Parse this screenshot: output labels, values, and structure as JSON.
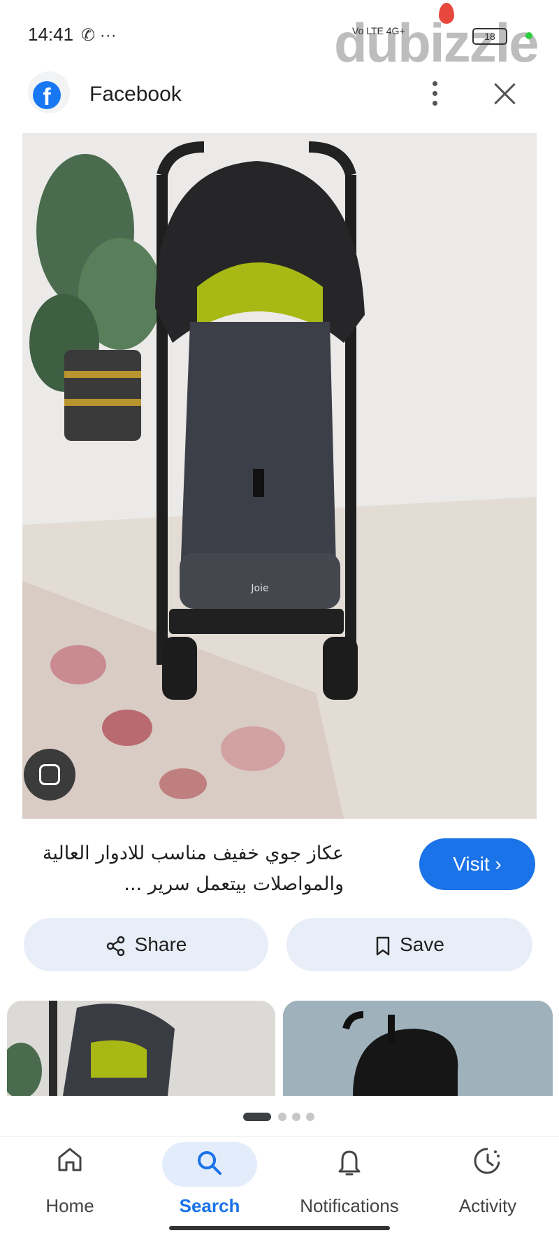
{
  "status_bar": {
    "time": "14:41",
    "left_icons": "✆ ···",
    "network": "Vo LTE 4G+",
    "battery": "18"
  },
  "watermark": "dubizzle",
  "header": {
    "source_name": "Facebook",
    "logo_letter": "f"
  },
  "result": {
    "caption": "عكاز جوي خفيف مناسب للادوار العالية والمواصلات بيتعمل سرير ...",
    "visit_label": "Visit ›",
    "image_brand": "Joie"
  },
  "actions": {
    "share_label": "Share",
    "save_label": "Save"
  },
  "bottom_nav": [
    {
      "label": "Home",
      "icon": "home-icon",
      "active": false
    },
    {
      "label": "Search",
      "icon": "search-icon",
      "active": true
    },
    {
      "label": "Notifications",
      "icon": "bell-icon",
      "active": false
    },
    {
      "label": "Activity",
      "icon": "activity-icon",
      "active": false
    }
  ],
  "colors": {
    "accent": "#1a73e8",
    "pill_bg": "#e8eef8",
    "stroller_green": "#a8b814"
  }
}
